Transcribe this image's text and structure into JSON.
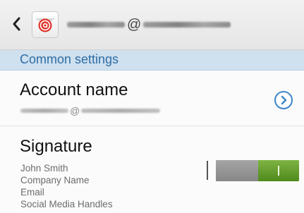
{
  "header": {
    "title_separator": "@",
    "back_icon": "chevron-left-icon",
    "app_icon": "email-app-icon"
  },
  "section": {
    "label": "Common settings"
  },
  "account": {
    "label": "Account name",
    "value_separator": "@",
    "action_icon": "chevron-right-circle-icon"
  },
  "signature": {
    "label": "Signature",
    "lines": [
      "John Smith",
      "Company Name",
      "Email",
      "Social Media Handles"
    ],
    "toggle_on": true
  },
  "colors": {
    "section_header_bg": "#cfe0ef",
    "section_header_text": "#2e6da4",
    "toggle_on": "#5f9a2a",
    "chevron_accent": "#3b86c8"
  }
}
